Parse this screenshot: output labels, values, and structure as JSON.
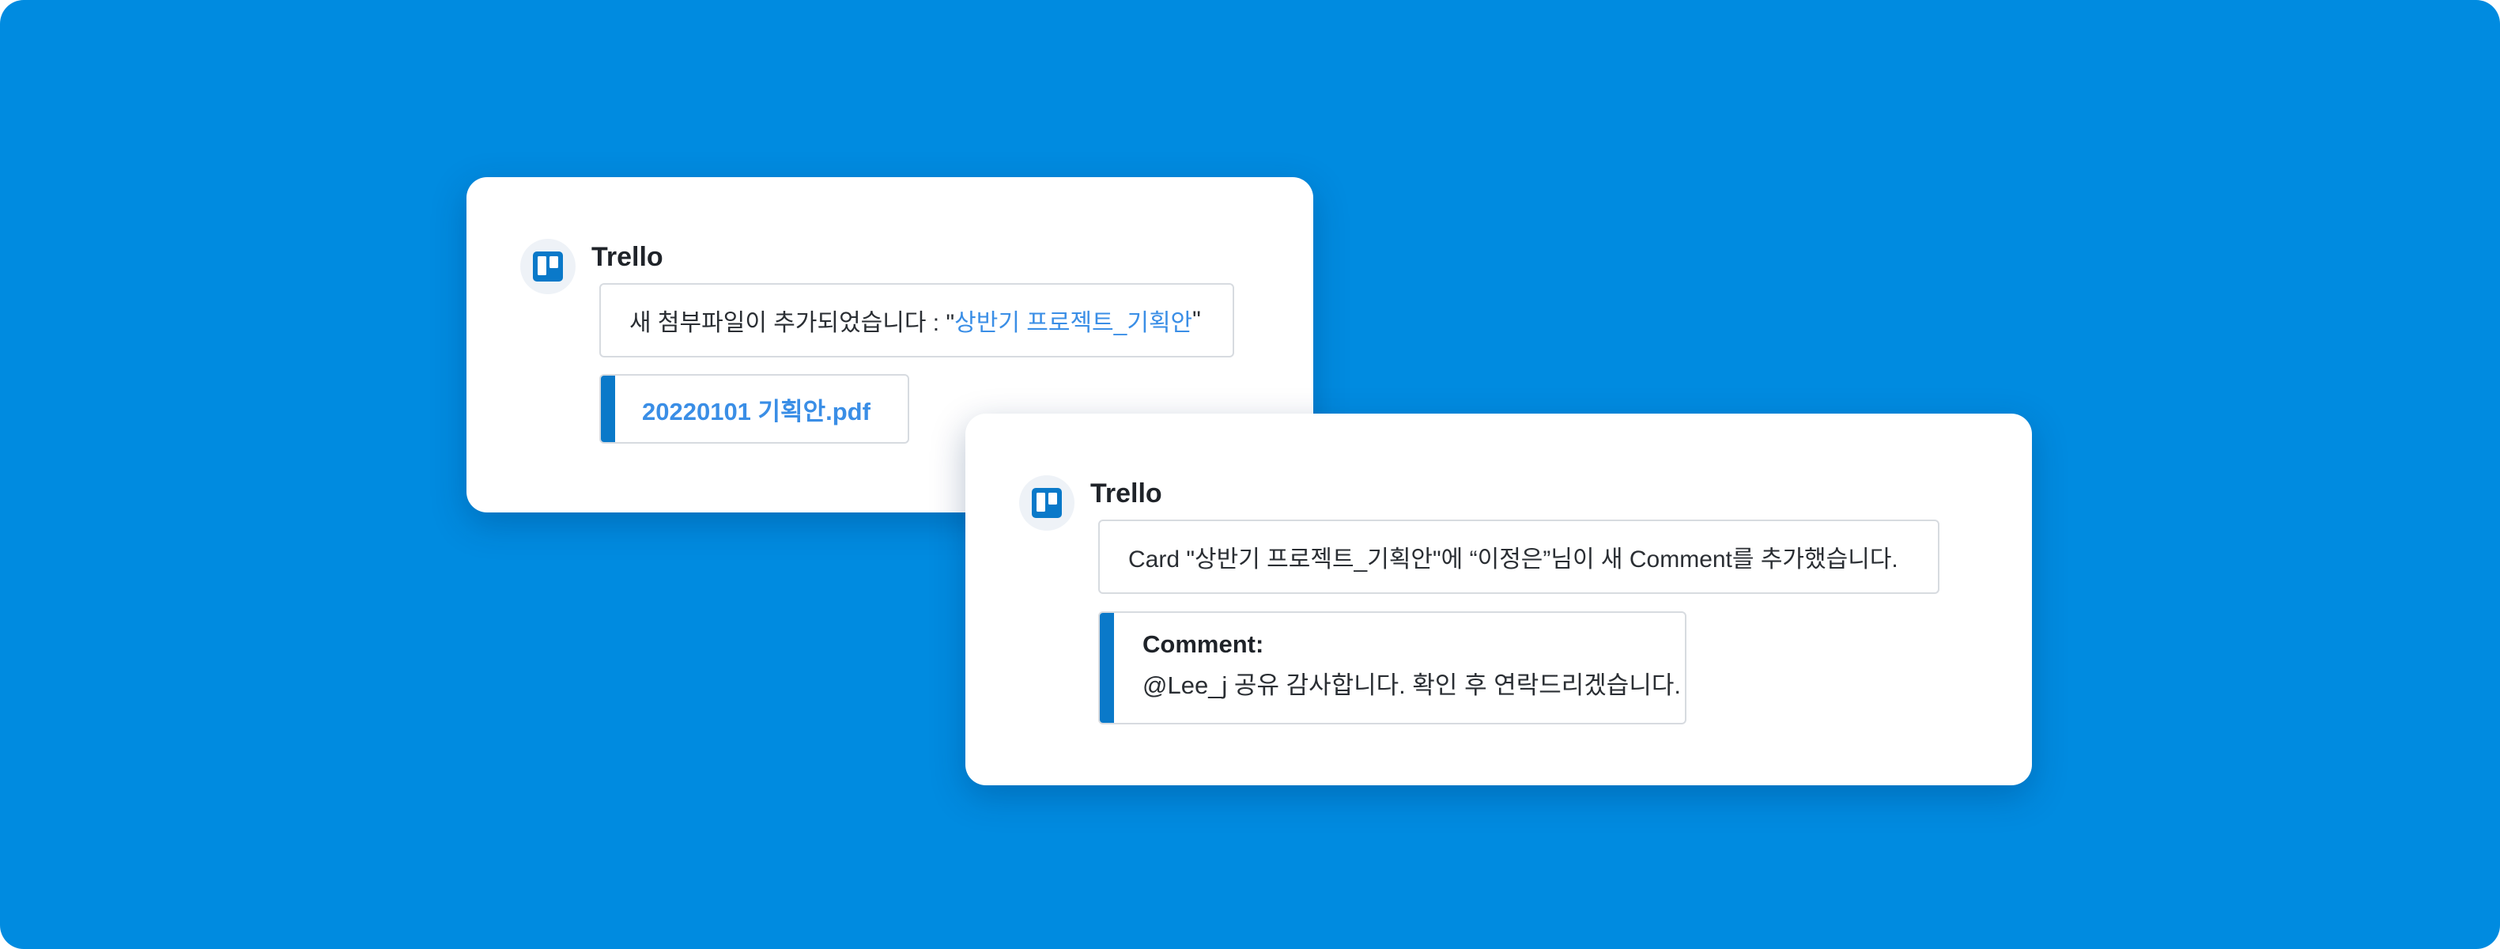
{
  "colors": {
    "background": "#008be0",
    "card": "#ffffff",
    "accent_bar": "#0a79c9",
    "link": "#3a8ee6"
  },
  "notifications": [
    {
      "app_icon": "trello-icon",
      "sender": "Trello",
      "message_prefix": "새 첨부파일이 추가되었습니다 :  \"",
      "message_link": "상반기 프로젝트_기획안",
      "message_suffix": "\"",
      "attachment": {
        "file_name": "20220101 기획안.pdf"
      }
    },
    {
      "app_icon": "trello-icon",
      "sender": "Trello",
      "message": "Card \"상반기 프로젝트_기획안\"에 “이정은”님이 새 Comment를 추가했습니다.",
      "comment": {
        "title": "Comment:",
        "body": "@Lee_j 공유 감사합니다. 확인 후 연락드리겠습니다."
      }
    }
  ]
}
